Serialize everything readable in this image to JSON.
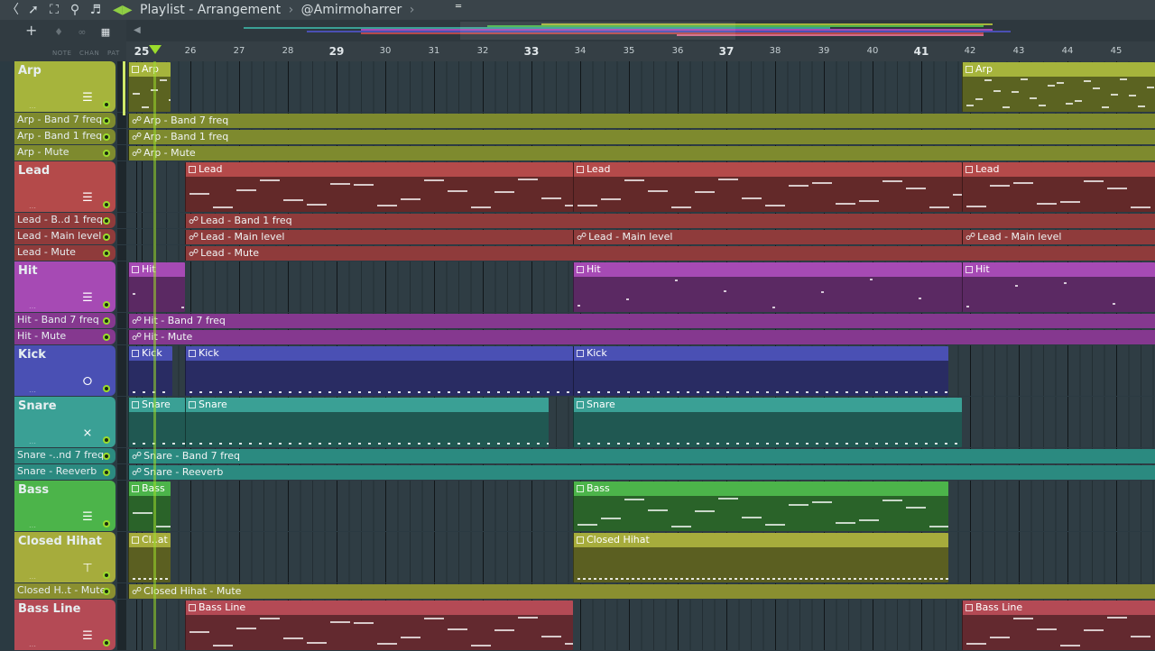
{
  "window": {
    "title": "Playlist - Arrangement",
    "separator": "›",
    "subtitle": "@Amirmoharrer",
    "toolbar_icons": [
      "snap-icon",
      "cursor-icon",
      "fullscreen-icon",
      "zoom-icon",
      "speaker-icon"
    ],
    "mode_labels": [
      "NOTE",
      "CHAN",
      "PAT"
    ]
  },
  "ruler": {
    "bars": [
      "25",
      "26",
      "27",
      "28",
      "29",
      "30",
      "31",
      "32",
      "33",
      "34",
      "35",
      "36",
      "37",
      "38",
      "39",
      "40",
      "41",
      "42",
      "43",
      "44",
      "45"
    ],
    "emphasized": [
      "25",
      "29",
      "33",
      "37",
      "41"
    ]
  },
  "colors": {
    "arp": "#a6b43c",
    "arp_auto": "#7e8a2e",
    "lead": "#b44a4a",
    "lead_auto": "#8f3b3b",
    "hit": "#a64ab4",
    "hit_auto": "#85388f",
    "kick": "#4a50b4",
    "snare": "#3aa095",
    "snare_auto": "#2b8a80",
    "bass": "#4cb44a",
    "hihat": "#a6ac3c",
    "hihat_auto": "#8a8f30",
    "bassline": "#b44a55"
  },
  "tracks": [
    {
      "id": "arp",
      "label": "Arp",
      "type": "instrument",
      "icon": "piano-icon"
    },
    {
      "id": "arp-b7",
      "label": "Arp - Band 7 freq",
      "type": "auto"
    },
    {
      "id": "arp-b1",
      "label": "Arp - Band 1 freq",
      "type": "auto"
    },
    {
      "id": "arp-mute",
      "label": "Arp - Mute",
      "type": "auto"
    },
    {
      "id": "lead",
      "label": "Lead",
      "type": "instrument",
      "icon": "piano-icon"
    },
    {
      "id": "lead-b1",
      "label": "Lead - B..d 1 freq",
      "type": "auto"
    },
    {
      "id": "lead-main",
      "label": "Lead - Main level",
      "type": "auto"
    },
    {
      "id": "lead-mute",
      "label": "Lead - Mute",
      "type": "auto"
    },
    {
      "id": "hit",
      "label": "Hit",
      "type": "instrument",
      "icon": "piano-icon"
    },
    {
      "id": "hit-b7",
      "label": "Hit - Band 7 freq",
      "type": "auto"
    },
    {
      "id": "hit-mute",
      "label": "Hit - Mute",
      "type": "auto"
    },
    {
      "id": "kick",
      "label": "Kick",
      "type": "instrument",
      "icon": "mouse-icon"
    },
    {
      "id": "snare",
      "label": "Snare",
      "type": "instrument",
      "icon": "drum-icon"
    },
    {
      "id": "snare-b7",
      "label": "Snare -..nd 7 freq",
      "type": "auto"
    },
    {
      "id": "snare-rev",
      "label": "Snare - Reeverb",
      "type": "auto"
    },
    {
      "id": "bass",
      "label": "Bass",
      "type": "instrument",
      "icon": "piano-icon"
    },
    {
      "id": "hihat",
      "label": "Closed Hihat",
      "type": "instrument",
      "icon": "hammer-icon"
    },
    {
      "id": "hihat-mute",
      "label": "Closed H..t - Mute",
      "type": "auto"
    },
    {
      "id": "bassline",
      "label": "Bass Line",
      "type": "instrument",
      "icon": "piano-icon"
    }
  ],
  "clips": {
    "arp": [
      {
        "label": "Arp"
      },
      {
        "label": "Arp"
      }
    ],
    "arp-b7": [
      {
        "label": "Arp - Band 7 freq"
      }
    ],
    "arp-b1": [
      {
        "label": "Arp - Band 1 freq"
      }
    ],
    "arp-mute": [
      {
        "label": "Arp - Mute"
      }
    ],
    "lead": [
      {
        "label": "Lead"
      },
      {
        "label": "Lead"
      },
      {
        "label": "Lead"
      }
    ],
    "lead-b1": [
      {
        "label": "Lead - Band 1 freq"
      }
    ],
    "lead-main": [
      {
        "label": "Lead - Main level"
      },
      {
        "label": "Lead - Main level"
      },
      {
        "label": "Lead - Main level"
      }
    ],
    "lead-mute": [
      {
        "label": "Lead - Mute"
      }
    ],
    "hit": [
      {
        "label": "Hit"
      },
      {
        "label": "Hit"
      },
      {
        "label": "Hit"
      }
    ],
    "hit-b7": [
      {
        "label": "Hit - Band 7 freq"
      }
    ],
    "hit-mute": [
      {
        "label": "Hit - Mute"
      }
    ],
    "kick": [
      {
        "label": "Kick"
      },
      {
        "label": "Kick"
      },
      {
        "label": "Kick"
      }
    ],
    "snare": [
      {
        "label": "Snare"
      },
      {
        "label": "Snare"
      },
      {
        "label": "Snare"
      }
    ],
    "snare-b7": [
      {
        "label": "Snare - Band 7 freq"
      }
    ],
    "snare-rev": [
      {
        "label": "Snare - Reeverb"
      }
    ],
    "bass": [
      {
        "label": "Bass"
      },
      {
        "label": "Bass"
      }
    ],
    "hihat": [
      {
        "label": "Cl..at"
      },
      {
        "label": "Closed Hihat"
      }
    ],
    "hihat-mute": [
      {
        "label": "Closed Hihat - Mute"
      }
    ],
    "bassline": [
      {
        "label": "Bass Line"
      },
      {
        "label": "Bass Line"
      }
    ]
  }
}
